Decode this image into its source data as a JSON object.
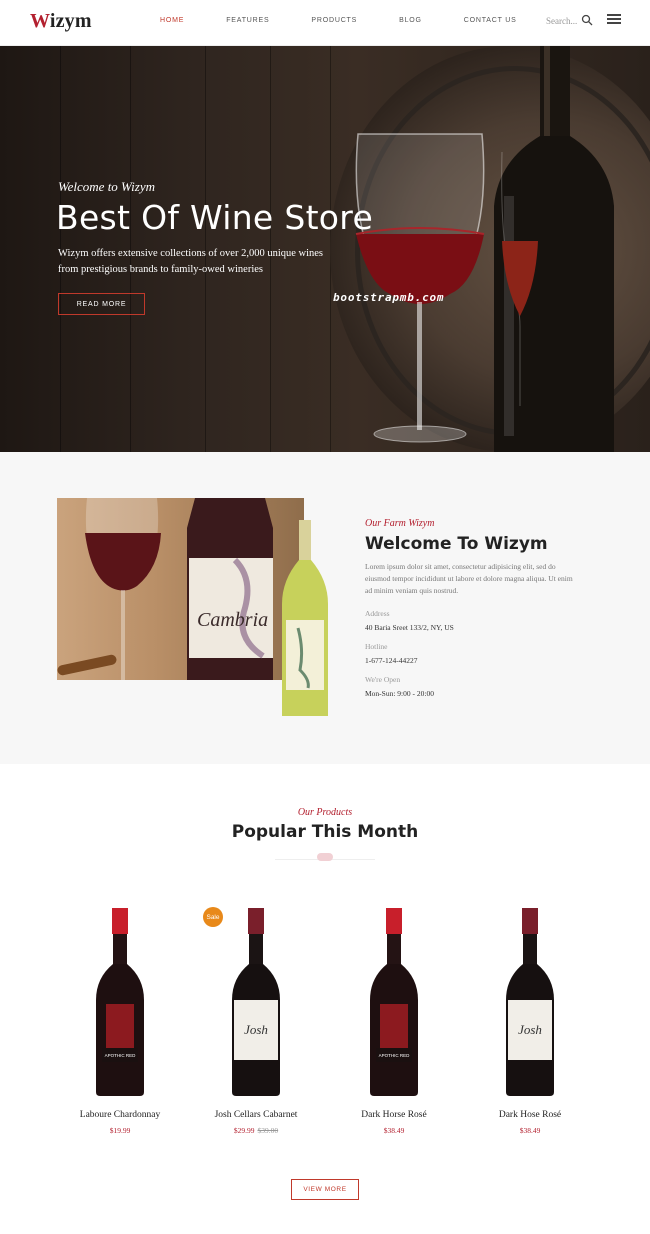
{
  "header": {
    "logo_first": "W",
    "logo_rest": "izym",
    "nav": [
      {
        "label": "HOME",
        "active": true
      },
      {
        "label": "FEATURES",
        "active": false
      },
      {
        "label": "PRODUCTS",
        "active": false
      },
      {
        "label": "BLOG",
        "active": false
      },
      {
        "label": "CONTACT US",
        "active": false
      }
    ],
    "search_placeholder": "Search..."
  },
  "hero": {
    "subtitle": "Welcome to Wizym",
    "title": "Best Of Wine Store",
    "description": "Wizym offers extensive collections of over 2,000 unique wines from prestigious brands to family-owed wineries",
    "button": "READ MORE",
    "watermark": "bootstrapmb.com"
  },
  "about": {
    "label": "Our Farm Wizym",
    "title": "Welcome To Wizym",
    "text": "Lorem ipsum dolor sit amet, consectetur adipisicing elit, sed do eiusmod tempor incididunt ut labore et dolore magna aliqua. Ut enim ad minim veniam quis nostrud.",
    "info": [
      {
        "label": "Address",
        "value": "40 Baria Sreet 133/2, NY, US"
      },
      {
        "label": "Hotline",
        "value": "1-677-124-44227"
      },
      {
        "label": "We're Open",
        "value": "Mon-Sun: 9:00 - 20:00"
      }
    ],
    "photo_label": "Cambria"
  },
  "products": {
    "subtitle": "Our Products",
    "title": "Popular This Month",
    "sale_badge": "Sale",
    "items": [
      {
        "name": "Laboure Chardonnay",
        "price": "$19.99",
        "old_price": "",
        "label_style": "red",
        "label_text": "APOTHIC RED"
      },
      {
        "name": "Josh Cellars Cabarnet",
        "price": "$29.99",
        "old_price": "$39.00",
        "label_style": "white",
        "label_text": "Josh"
      },
      {
        "name": "Dark Horse Rosé",
        "price": "$38.49",
        "old_price": "",
        "label_style": "red",
        "label_text": "APOTHIC RED"
      },
      {
        "name": "Dark Hose Rosé",
        "price": "$38.49",
        "old_price": "",
        "label_style": "white",
        "label_text": "Josh"
      }
    ],
    "view_more": "VIEW MORE"
  },
  "colors": {
    "accent": "#b3202f",
    "sale": "#e8891a",
    "hero_bg": "#2f251f",
    "about_bg": "#f7f7f7"
  }
}
